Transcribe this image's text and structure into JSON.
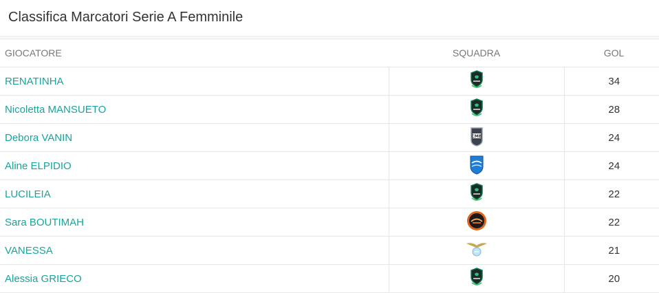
{
  "title": "Classifica Marcatori Serie A Femminile",
  "headers": {
    "player": "GIOCATORE",
    "team": "SQUADRA",
    "goals": "GOL"
  },
  "colors": {
    "link": "#19a39a",
    "border": "#e6e6e6",
    "header_text": "#777777"
  },
  "rows": [
    {
      "player": "RENATINHA",
      "team_icon": "green-black-crest-icon",
      "goals": "34"
    },
    {
      "player": "Nicoletta MANSUETO",
      "team_icon": "green-black-crest-icon",
      "goals": "28"
    },
    {
      "player": "Debora VANIN",
      "team_icon": "grey-cmb-crest-icon",
      "goals": "24"
    },
    {
      "player": "Aline ELPIDIO",
      "team_icon": "blue-shield-crest-icon",
      "goals": "24"
    },
    {
      "player": "LUCILEIA",
      "team_icon": "green-black-crest-icon",
      "goals": "22"
    },
    {
      "player": "Sara BOUTIMAH",
      "team_icon": "orange-round-crest-icon",
      "goals": "22"
    },
    {
      "player": "VANESSA",
      "team_icon": "eagle-crest-icon",
      "goals": "21"
    },
    {
      "player": "Alessia GRIECO",
      "team_icon": "green-black-crest-icon",
      "goals": "20"
    }
  ]
}
